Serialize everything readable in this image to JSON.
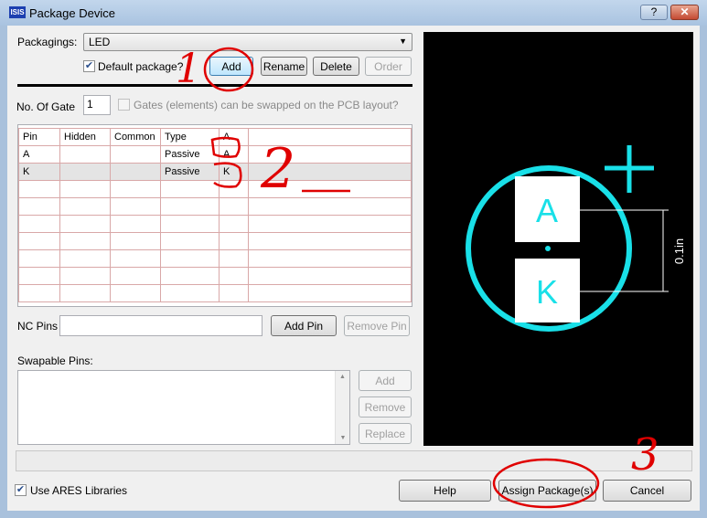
{
  "window": {
    "title": "Package Device",
    "app_icon": "ISIS",
    "help": "?",
    "close": "✕"
  },
  "packagings": {
    "label": "Packagings:",
    "value": "LED",
    "default_label": "Default package?",
    "default_checked": true,
    "buttons": {
      "add": "Add",
      "rename": "Rename",
      "delete": "Delete",
      "order": "Order"
    }
  },
  "gates": {
    "label": "No. Of Gate",
    "value": "1",
    "swap_label": "Gates (elements) can be swapped on the PCB layout?",
    "swap_checked": false
  },
  "pin_table": {
    "headers": [
      "Pin",
      "Hidden",
      "Common",
      "Type",
      "A"
    ],
    "rows": [
      [
        "A",
        "",
        "",
        "Passive",
        "A"
      ],
      [
        "K",
        "",
        "",
        "Passive",
        "K"
      ]
    ]
  },
  "nc_pins": {
    "label": "NC Pins",
    "value": "",
    "add": "Add Pin",
    "remove": "Remove Pin"
  },
  "swapable": {
    "label": "Swapable Pins:",
    "add": "Add",
    "remove": "Remove",
    "replace": "Replace"
  },
  "footer": {
    "use_ares_label": "Use ARES Libraries",
    "use_ares_checked": true,
    "help": "Help",
    "assign": "Assign Package(s)",
    "cancel": "Cancel"
  },
  "preview": {
    "pad1": "A",
    "pad2": "K",
    "dimension": "0.1in",
    "plus": "+",
    "colors": {
      "outline": "#19e0e8",
      "pad": "#ffffff",
      "background": "#000000"
    }
  },
  "annotations": [
    "1",
    "2",
    "3"
  ]
}
